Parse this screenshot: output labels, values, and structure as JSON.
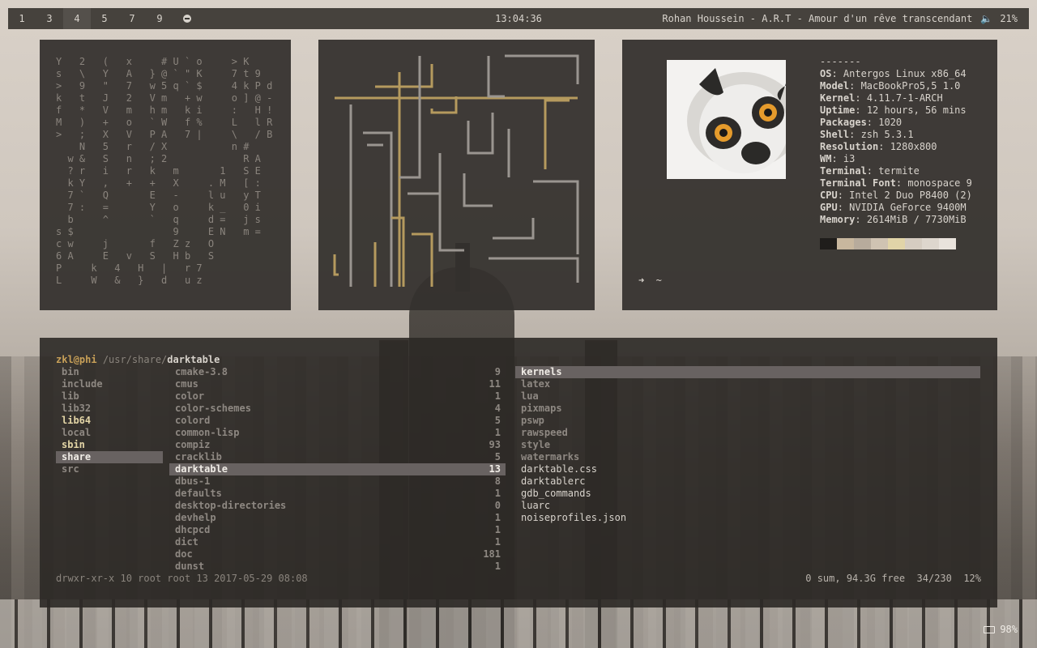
{
  "workspaces": [
    "1",
    "3",
    "4",
    "5",
    "7",
    "9"
  ],
  "active_workspace": "4",
  "clock": "13:04:36",
  "now_playing": "Rohan Houssein - A.R.T - Amour d'un rêve transcendant",
  "volume": "21%",
  "matrix_lines": [
    "Y   2   (   x     # U ` o     > K",
    "s   \\   Y   A   } @ ` \" K     7 t 9",
    ">   9   \"   7   w 5 q ` $     4 k P d",
    "k   t   J   2   V m   + w     o ] @ -",
    "f   *   V   m   h m   k i     :   H !",
    "M   )   +   o   ` W   f %     L   l R",
    ">   ;   X   V   P A   7 |     \\   / B",
    "    N   5   r   / X           n #",
    "  w &   S   n   ; 2             R A",
    "  ? r   i   r   k   m       1   S E",
    "  k Y   ,   +   +   X     . M   [ :",
    "  7 `   Q       E   -     l u   y T",
    "  7 :   =       Y   o     k _   0 i",
    "  b     ^       `   q     d =   j s",
    "s $                 9     E N   m =",
    "c w     j       f   Z z   O",
    "6 A     E   v   S   H b   S",
    "P     k   4   H   |   r 7",
    "L     W   &   }   d   u z"
  ],
  "neofetch": {
    "separator": "-------",
    "rows": [
      {
        "key": "OS",
        "value": "Antergos Linux x86_64"
      },
      {
        "key": "Model",
        "value": "MacBookPro5,5 1.0"
      },
      {
        "key": "Kernel",
        "value": "4.11.7-1-ARCH"
      },
      {
        "key": "Uptime",
        "value": "12 hours, 56 mins"
      },
      {
        "key": "Packages",
        "value": "1020"
      },
      {
        "key": "Shell",
        "value": "zsh 5.3.1"
      },
      {
        "key": "Resolution",
        "value": "1280x800"
      },
      {
        "key": "WM",
        "value": "i3"
      },
      {
        "key": "Terminal",
        "value": "termite"
      },
      {
        "key": "Terminal Font",
        "value": "monospace 9"
      },
      {
        "key": "CPU",
        "value": "Intel 2 Duo P8400 (2)"
      },
      {
        "key": "GPU",
        "value": "NVIDIA GeForce 9400M"
      },
      {
        "key": "Memory",
        "value": "2614MiB / 7730MiB"
      }
    ],
    "swatches": [
      "#1f1d1b",
      "#c8b79e",
      "#b7ab9c",
      "#cfc3b2",
      "#e1d4a8",
      "#d5ccc1",
      "#ddd6cd",
      "#e9e3dc"
    ],
    "prompt": "➜  ~"
  },
  "ranger": {
    "user": "zkl@phi",
    "path_prefix": "/usr/share/",
    "current_dir": "darktable",
    "parent": [
      {
        "name": "bin",
        "style": "dim"
      },
      {
        "name": "include",
        "style": "dim"
      },
      {
        "name": "lib",
        "style": "dim"
      },
      {
        "name": "lib32",
        "style": "dim"
      },
      {
        "name": "lib64",
        "style": "yellow"
      },
      {
        "name": "local",
        "style": "dim"
      },
      {
        "name": "sbin",
        "style": "yellow"
      },
      {
        "name": "share",
        "style": "sel"
      },
      {
        "name": "src",
        "style": "dim"
      }
    ],
    "current": [
      {
        "name": "cmake-3.8",
        "count": "9"
      },
      {
        "name": "cmus",
        "count": "11"
      },
      {
        "name": "color",
        "count": "1"
      },
      {
        "name": "color-schemes",
        "count": "4"
      },
      {
        "name": "colord",
        "count": "5"
      },
      {
        "name": "common-lisp",
        "count": "1"
      },
      {
        "name": "compiz",
        "count": "93"
      },
      {
        "name": "cracklib",
        "count": "5"
      },
      {
        "name": "darktable",
        "count": "13",
        "selected": true
      },
      {
        "name": "dbus-1",
        "count": "8"
      },
      {
        "name": "defaults",
        "count": "1"
      },
      {
        "name": "desktop-directories",
        "count": "0"
      },
      {
        "name": "devhelp",
        "count": "1"
      },
      {
        "name": "dhcpcd",
        "count": "1"
      },
      {
        "name": "dict",
        "count": "1"
      },
      {
        "name": "doc",
        "count": "181"
      },
      {
        "name": "dunst",
        "count": "1"
      }
    ],
    "preview": [
      {
        "name": "kernels",
        "type": "dir",
        "selected": true
      },
      {
        "name": "latex",
        "type": "dir"
      },
      {
        "name": "lua",
        "type": "dir"
      },
      {
        "name": "pixmaps",
        "type": "dir"
      },
      {
        "name": "pswp",
        "type": "dir"
      },
      {
        "name": "rawspeed",
        "type": "dir"
      },
      {
        "name": "style",
        "type": "dir"
      },
      {
        "name": "watermarks",
        "type": "dir"
      },
      {
        "name": "darktable.css",
        "type": "file"
      },
      {
        "name": "darktablerc",
        "type": "file"
      },
      {
        "name": "gdb_commands",
        "type": "file"
      },
      {
        "name": "luarc",
        "type": "file"
      },
      {
        "name": "noiseprofiles.json",
        "type": "file"
      }
    ],
    "status_left": "drwxr-xr-x 10 root root 13 2017-05-29 08:08",
    "status_right": "0 sum, 94.3G free  34/230  12%"
  },
  "battery": "98%",
  "colors": {
    "accent": "#c8a058",
    "panel": "#34312e",
    "text": "#d8d3cc",
    "pipe_gold": "#b59a5e",
    "pipe_gray": "#9a9590"
  }
}
